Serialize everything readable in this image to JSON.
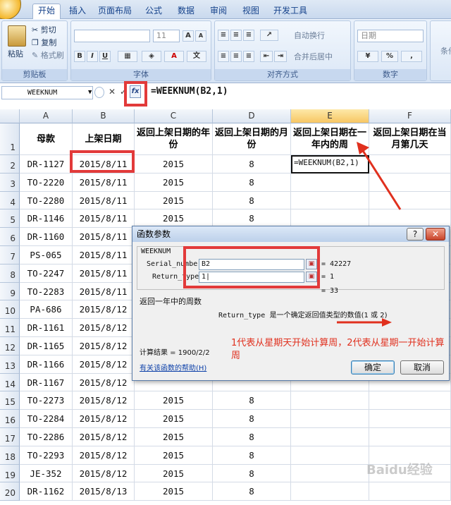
{
  "tabs": [
    "开始",
    "插入",
    "页面布局",
    "公式",
    "数据",
    "审阅",
    "视图",
    "开发工具"
  ],
  "clipboard": {
    "paste": "粘贴",
    "cut": "剪切",
    "copy": "复制",
    "format_painter": "格式刷",
    "group": "剪贴板"
  },
  "font": {
    "size": "11",
    "group": "字体",
    "bold": "B",
    "italic": "I",
    "underline": "U",
    "grow": "A",
    "shrink": "A",
    "color_letter": "A",
    "phonetic": "文"
  },
  "alignment": {
    "wrap": "自动换行",
    "merge": "合并后居中",
    "group": "对齐方式"
  },
  "number": {
    "format": "日期",
    "percent": "%",
    "group": "数字"
  },
  "styles_partial": "条件",
  "formula_bar": {
    "name_box": "WEEKNUM",
    "cancel": "✕",
    "enter": "✓",
    "fx": "fx",
    "formula": "=WEEKNUM(B2,1)"
  },
  "columns": [
    "A",
    "B",
    "C",
    "D",
    "E",
    "F"
  ],
  "headers": [
    "母款",
    "上架日期",
    "返回上架日期的年份",
    "返回上架日期的月份",
    "返回上架日期在一年内的周",
    "返回上架日期在当月第几天"
  ],
  "rows": [
    {
      "n": "1"
    },
    {
      "n": "2",
      "a": "DR-1127",
      "b": "2015/8/11",
      "c": "2015",
      "d": "8",
      "e": "=WEEKNUM(B2,1)"
    },
    {
      "n": "3",
      "a": "TO-2220",
      "b": "2015/8/11",
      "c": "2015",
      "d": "8"
    },
    {
      "n": "4",
      "a": "TO-2280",
      "b": "2015/8/11",
      "c": "2015",
      "d": "8"
    },
    {
      "n": "5",
      "a": "DR-1146",
      "b": "2015/8/11",
      "c": "2015",
      "d": "8"
    },
    {
      "n": "6",
      "a": "DR-1160",
      "b": "2015/8/11"
    },
    {
      "n": "7",
      "a": "PS-065",
      "b": "2015/8/11"
    },
    {
      "n": "8",
      "a": "TO-2247",
      "b": "2015/8/11"
    },
    {
      "n": "9",
      "a": "TO-2283",
      "b": "2015/8/11"
    },
    {
      "n": "10",
      "a": "PA-686",
      "b": "2015/8/12"
    },
    {
      "n": "11",
      "a": "DR-1161",
      "b": "2015/8/12"
    },
    {
      "n": "12",
      "a": "DR-1165",
      "b": "2015/8/12"
    },
    {
      "n": "13",
      "a": "DR-1166",
      "b": "2015/8/12"
    },
    {
      "n": "14",
      "a": "DR-1167",
      "b": "2015/8/12"
    },
    {
      "n": "15",
      "a": "TO-2273",
      "b": "2015/8/12",
      "c": "2015",
      "d": "8"
    },
    {
      "n": "16",
      "a": "TO-2284",
      "b": "2015/8/12",
      "c": "2015",
      "d": "8"
    },
    {
      "n": "17",
      "a": "TO-2286",
      "b": "2015/8/12",
      "c": "2015",
      "d": "8"
    },
    {
      "n": "18",
      "a": "TO-2293",
      "b": "2015/8/12",
      "c": "2015",
      "d": "8"
    },
    {
      "n": "19",
      "a": "JE-352",
      "b": "2015/8/12",
      "c": "2015",
      "d": "8"
    },
    {
      "n": "20",
      "a": "DR-1162",
      "b": "2015/8/13",
      "c": "2015",
      "d": "8"
    }
  ],
  "dialog": {
    "title": "函数参数",
    "help_q": "?",
    "close": "✕",
    "func": "WEEKNUM",
    "arg1_label": "Serial_number",
    "arg1_value": "B2",
    "arg1_result": "= 42227",
    "arg2_label": "Return_type",
    "arg2_value": "1|",
    "arg2_result": "= 1",
    "total": "= 33",
    "desc": "返回一年中的周数",
    "arg_desc_name": "Return_type",
    "arg_desc": "是一个确定返回值类型的数值(1 或 2)",
    "calc_result": "计算结果 = 1900/2/2",
    "help_link": "有关该函数的帮助(H)",
    "ok": "确定",
    "cancel": "取消"
  },
  "annotation": "1代表从星期天开始计算周，2代表从星期一开始计算周",
  "watermark": "Baidu经验",
  "colors": {
    "accent_red": "#e23a3a",
    "annotation_red": "#e0301e",
    "link_blue": "#0b3fa8"
  }
}
